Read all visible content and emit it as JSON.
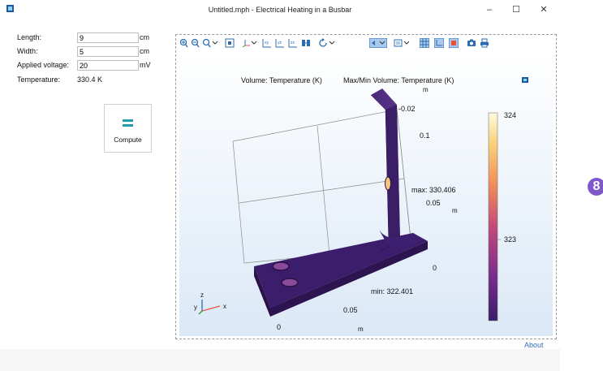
{
  "window": {
    "title": "Untitled.mph - Electrical Heating in a Busbar",
    "minimize": "–",
    "maximize": "☐",
    "close": "✕"
  },
  "form": {
    "length": {
      "label": "Length:",
      "value": "9",
      "unit": "cm"
    },
    "width": {
      "label": "Width:",
      "value": "5",
      "unit": "cm"
    },
    "voltage": {
      "label": "Applied voltage:",
      "value": "20",
      "unit": "mV"
    },
    "temperature": {
      "label": "Temperature:",
      "value": "330.4 K"
    }
  },
  "compute": {
    "label": "Compute",
    "icon": "equals-icon"
  },
  "plot": {
    "title_left": "Volume: Temperature (K)",
    "title_right": "Max/Min Volume: Temperature (K)",
    "title_unit": "m",
    "max_label": "max: 330.406",
    "min_label": "min: 322.401",
    "axis_ticks_right": [
      "-0.02",
      "0.1",
      "0.05",
      "0"
    ],
    "axis_unit_right": "m",
    "axis_ticks_bottom": [
      "0.05",
      "0"
    ],
    "axis_unit_bottom": "m",
    "colorbar": {
      "top": "324",
      "mid": "323"
    },
    "triad": {
      "x": "x",
      "y": "y",
      "z": "z"
    },
    "colors": {
      "solid": "#4a2a7a",
      "hot": "#f4c77a",
      "cool": "#3b1d6b",
      "accent": "#e8533a"
    }
  },
  "toolbar_icons": [
    "zoom-in-icon",
    "zoom-out-icon",
    "zoom-box-icon",
    "zoom-extents-icon",
    "axis-icon",
    "view-xy-icon",
    "view-yz-icon",
    "view-zx-icon",
    "view-default-icon",
    "rotate-icon",
    "scene-light-icon",
    "transparency-icon",
    "grid-icon",
    "axes-toggle-icon",
    "render-icon",
    "camera-icon",
    "print-icon"
  ],
  "about": "About",
  "badge": "8"
}
